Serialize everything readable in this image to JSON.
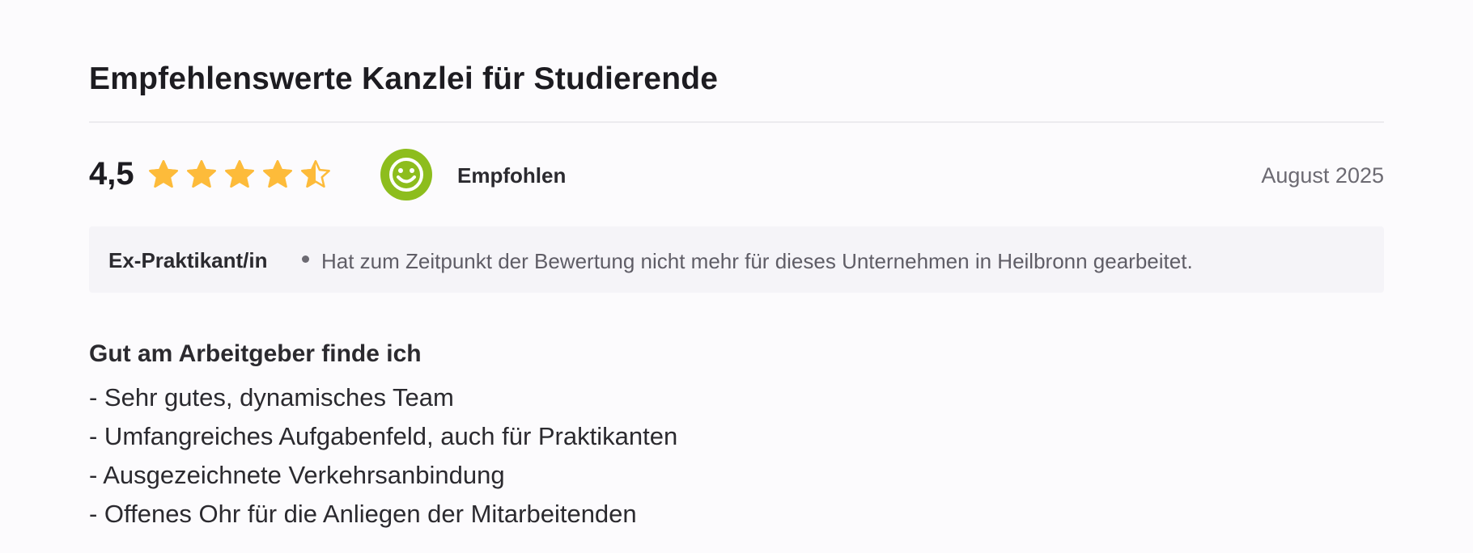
{
  "review": {
    "title": "Empfehlenswerte Kanzlei für Studierende",
    "score": "4,5",
    "stars": {
      "value": 4.5,
      "max": 5,
      "color": "#fdbb3a"
    },
    "recommendation": {
      "label": "Empfohlen",
      "icon": "smiley-icon",
      "color": "#8dbd1d"
    },
    "date": "August 2025",
    "status": {
      "role": "Ex-Praktikant/in",
      "text": "Hat zum Zeitpunkt der Bewertung nicht mehr für dieses Unternehmen in Heilbronn gearbeitet."
    },
    "pros": {
      "heading": "Gut am Arbeitgeber finde ich",
      "items": [
        "- Sehr gutes, dynamisches Team",
        "- Umfangreiches Aufgabenfeld, auch für Praktikanten",
        "- Ausgezeichnete Verkehrsanbindung",
        "- Offenes Ohr für die Anliegen der Mitarbeitenden"
      ]
    }
  }
}
